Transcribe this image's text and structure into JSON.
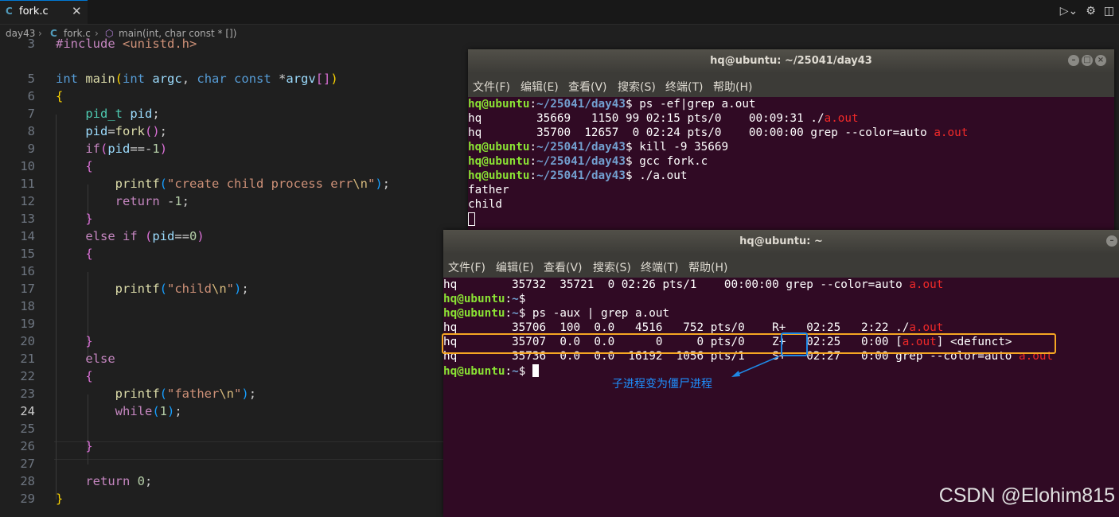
{
  "editor": {
    "tab": {
      "icon": "C",
      "label": "fork.c",
      "close": "✕"
    },
    "breadcrumb": {
      "folder": "day43",
      "file_icon": "C",
      "file": "fork.c",
      "symbol": "main(int, char const * [])"
    },
    "current_line": "24",
    "line_numbers": [
      "3",
      "5",
      "6",
      "7",
      "8",
      "9",
      "10",
      "11",
      "12",
      "13",
      "14",
      "15",
      "16",
      "17",
      "18",
      "19",
      "20",
      "21",
      "22",
      "23",
      "24",
      "25",
      "26",
      "27",
      "28",
      "29"
    ]
  },
  "terminal1": {
    "title": "hq@ubuntu: ~/25041/day43",
    "menu": [
      "文件(F)",
      "编辑(E)",
      "查看(V)",
      "搜索(S)",
      "终端(T)",
      "帮助(H)"
    ],
    "prompt_user": "hq@ubuntu",
    "prompt_path": "~/25041/day43",
    "cmd1": "ps -ef|grep a.out",
    "r1_pre": "hq        35669   1150 99 02:15 pts/0    00:09:31 ./",
    "r2_pre": "hq        35700  12657  0 02:24 pts/0    00:00:00 grep --color=auto ",
    "match": "a.out",
    "cmd2": "kill -9 35669",
    "cmd3": "gcc fork.c",
    "cmd4": "./a.out",
    "out1": "father",
    "out2": "child"
  },
  "terminal2": {
    "title": "hq@ubuntu: ~",
    "menu": [
      "文件(F)",
      "编辑(E)",
      "查看(V)",
      "搜索(S)",
      "终端(T)",
      "帮助(H)"
    ],
    "prompt_user": "hq@ubuntu",
    "prompt_path": "~",
    "r0_pre": "hq        35732  35721  0 02:26 pts/1    00:00:00 grep --color=auto ",
    "match": "a.out",
    "cmd": "ps -aux | grep a.out",
    "r1_pre": "hq        35706  100  0.0   4516   752 pts/0    R+   02:25   2:22 ./",
    "r2_pre": "hq        35707  0.0  0.0      0     0 pts/0    Z+   02:25   0:00 [",
    "r2_post": "] <defunct>",
    "r3_pre": "hq        35736  0.0  0.0  16192  1056 pts/1    S+   02:27   0:00 grep --color=auto ",
    "annotation": "子进程变为僵尸进程"
  },
  "watermark": "CSDN @Elohim815",
  "colors": {
    "terminal_bg": "#300a24",
    "prompt_green": "#8ae234",
    "prompt_blue": "#729fcf",
    "match_red": "#ef2929",
    "highlight_orange": "#f5a623",
    "highlight_blue": "#1e88e5"
  }
}
